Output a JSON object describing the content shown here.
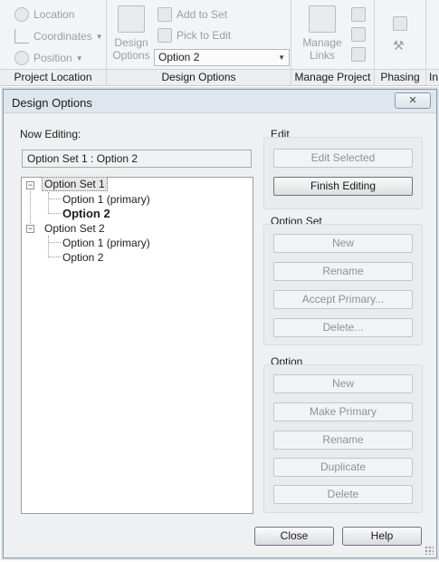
{
  "ribbon": {
    "location_label": "Location",
    "coordinates_label": "Coordinates",
    "position_label": "Position",
    "project_location_title": "Project Location",
    "design_options_big_label": "Design\nOptions",
    "add_to_set_label": "Add to Set",
    "pick_to_edit_label": "Pick to Edit",
    "option_select_value": "Option 2",
    "design_options_title": "Design Options",
    "manage_links_label": "Manage\nLinks",
    "manage_project_title": "Manage Project",
    "phasing_title": "Phasing",
    "next_title": "In"
  },
  "dialog": {
    "title": "Design Options",
    "close_x": "✕",
    "now_editing_label": "Now Editing:",
    "now_editing_value": "Option Set 1 : Option 2",
    "tree": {
      "set1": "Option Set 1",
      "set1_opt1": "Option 1 (primary)",
      "set1_opt2": "Option 2",
      "set2": "Option Set 2",
      "set2_opt1": "Option 1 (primary)",
      "set2_opt2": "Option 2"
    },
    "edit_group": {
      "title": "Edit",
      "edit_selected": "Edit Selected",
      "finish_editing": "Finish Editing"
    },
    "option_set_group": {
      "title": "Option Set",
      "new": "New",
      "rename": "Rename",
      "accept_primary": "Accept Primary...",
      "delete": "Delete..."
    },
    "option_group": {
      "title": "Option",
      "new": "New",
      "make_primary": "Make Primary",
      "rename": "Rename",
      "duplicate": "Duplicate",
      "delete": "Delete"
    },
    "close_button": "Close",
    "help_button": "Help"
  },
  "colors": {
    "dialog_bg": "#eef0f2",
    "disabled_text": "#8e9196",
    "ribbon_bg": "#f3f4f6"
  }
}
